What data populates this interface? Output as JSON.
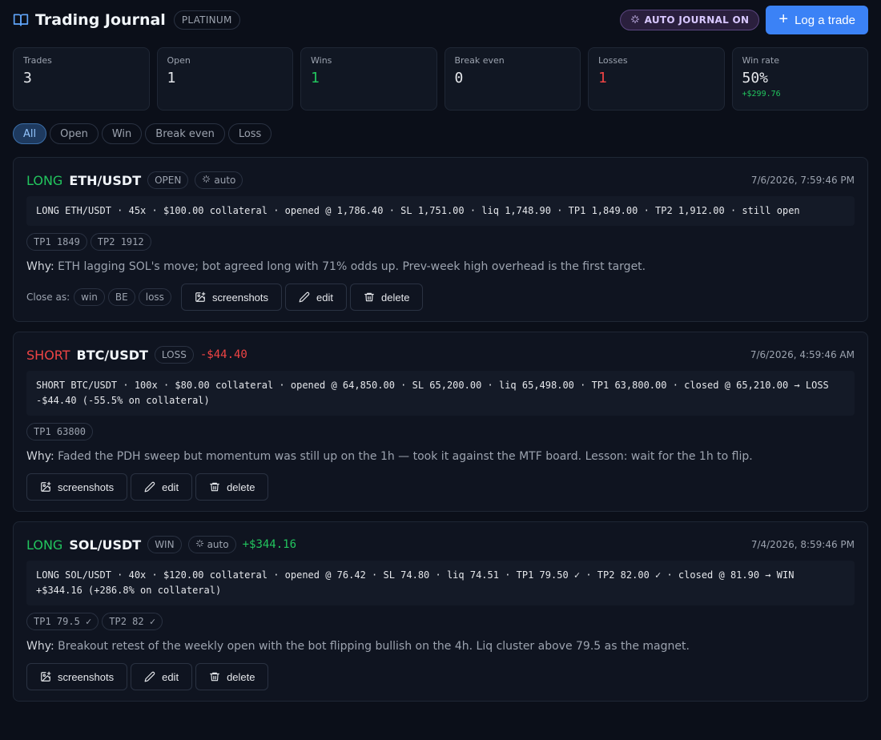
{
  "header": {
    "title": "Trading Journal",
    "plan": "PLATINUM",
    "auto_journal": "AUTO JOURNAL ON",
    "log_button": "Log a trade",
    "book_icon": "book-open-icon",
    "plus_icon": "plus-icon",
    "sparkle_icon": "sparkles-icon"
  },
  "stats": [
    {
      "label": "Trades",
      "value": "3"
    },
    {
      "label": "Open",
      "value": "1"
    },
    {
      "label": "Wins",
      "value": "1"
    },
    {
      "label": "Break even",
      "value": "0"
    },
    {
      "label": "Losses",
      "value": "1"
    },
    {
      "label": "Win rate",
      "value": "50%",
      "sub": "+$299.76"
    }
  ],
  "filters": [
    "All",
    "Open",
    "Win",
    "Break even",
    "Loss"
  ],
  "trades": [
    {
      "side": "LONG",
      "pair": "ETH/USDT",
      "status": "OPEN",
      "auto": "auto",
      "timestamp": "7/6/2026, 7:59:46 PM",
      "summary": "LONG ETH/USDT · 45x · $100.00 collateral · opened @ 1,786.40 · SL 1,751.00 · liq 1,748.90 · TP1 1,849.00 · TP2 1,912.00 · still open",
      "tps": [
        "TP1 1849",
        "TP2 1912"
      ],
      "why_label": "Why:",
      "why": "ETH lagging SOL's move; bot agreed long with 71% odds up. Prev-week high overhead is the first target.",
      "close_as_label": "Close as:",
      "close_as": [
        "win",
        "BE",
        "loss"
      ]
    },
    {
      "side": "SHORT",
      "pair": "BTC/USDT",
      "status": "LOSS",
      "pnl": "-$44.40",
      "timestamp": "7/6/2026, 4:59:46 AM",
      "summary_line1": "SHORT BTC/USDT · 100x · $80.00 collateral · opened @ 64,850.00 · SL 65,200.00 · liq 65,498.00 · TP1 63,800.00 · closed @ 65,210.00 → LOSS",
      "summary_line2": "-$44.40 (-55.5% on collateral)",
      "tps": [
        "TP1 63800"
      ],
      "why_label": "Why:",
      "why": "Faded the PDH sweep but momentum was still up on the 1h — took it against the MTF board. Lesson: wait for the 1h to flip."
    },
    {
      "side": "LONG",
      "pair": "SOL/USDT",
      "status": "WIN",
      "auto": "auto",
      "pnl": "+$344.16",
      "timestamp": "7/4/2026, 8:59:46 PM",
      "summary_line1": "LONG SOL/USDT · 40x · $120.00 collateral · opened @ 76.42 · SL 74.80 · liq 74.51 · TP1 79.50 ✓ · TP2 82.00 ✓ · closed @ 81.90 → WIN",
      "summary_line2": "+$344.16 (+286.8% on collateral)",
      "tps": [
        "TP1 79.5 ✓",
        "TP2 82 ✓"
      ],
      "why_label": "Why:",
      "why": "Breakout retest of the weekly open with the bot flipping bullish on the 4h. Liq cluster above 79.5 as the magnet."
    }
  ],
  "actions": {
    "screenshots": "screenshots",
    "edit": "edit",
    "delete": "delete"
  },
  "colors": {
    "background": "#0b0f19",
    "accent": "#3b82f6",
    "positive": "#22c55e",
    "negative": "#ef4444"
  }
}
